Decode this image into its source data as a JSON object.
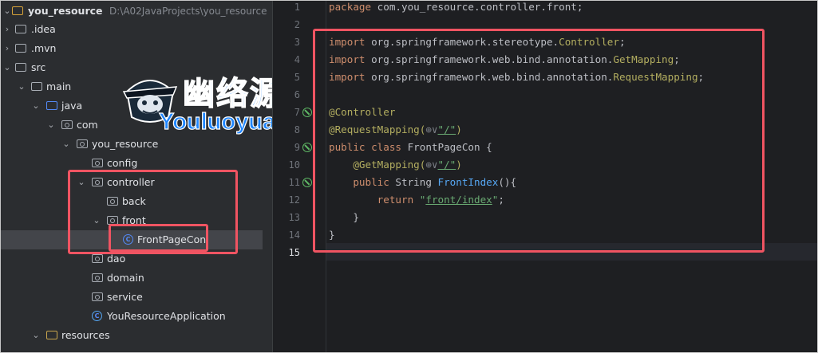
{
  "project": {
    "name": "you_resource",
    "path": "D:\\A02JavaProjects\\you_resource",
    "tree": [
      {
        "label": "you_resource",
        "depth": 0,
        "expanded": true,
        "icon": "folder"
      },
      {
        "label": ".idea",
        "depth": 1,
        "expanded": false,
        "icon": "folder"
      },
      {
        "label": ".mvn",
        "depth": 1,
        "expanded": false,
        "icon": "folder"
      },
      {
        "label": "src",
        "depth": 1,
        "expanded": true,
        "icon": "folder"
      },
      {
        "label": "main",
        "depth": 2,
        "expanded": true,
        "icon": "folder"
      },
      {
        "label": "java",
        "depth": 3,
        "expanded": true,
        "icon": "source-folder"
      },
      {
        "label": "com",
        "depth": 4,
        "expanded": true,
        "icon": "package"
      },
      {
        "label": "you_resource",
        "depth": 5,
        "expanded": true,
        "icon": "package"
      },
      {
        "label": "config",
        "depth": 6,
        "icon": "package"
      },
      {
        "label": "controller",
        "depth": 6,
        "expanded": true,
        "icon": "package"
      },
      {
        "label": "back",
        "depth": 7,
        "icon": "package"
      },
      {
        "label": "front",
        "depth": 7,
        "expanded": true,
        "icon": "package"
      },
      {
        "label": "FrontPageCon",
        "depth": 8,
        "icon": "class",
        "selected": true
      },
      {
        "label": "dao",
        "depth": 6,
        "icon": "package"
      },
      {
        "label": "domain",
        "depth": 6,
        "icon": "package"
      },
      {
        "label": "service",
        "depth": 6,
        "icon": "package"
      },
      {
        "label": "YouResourceApplication",
        "depth": 6,
        "icon": "spring-class"
      },
      {
        "label": "resources",
        "depth": 3,
        "expanded": true,
        "icon": "resources-folder"
      }
    ]
  },
  "editor": {
    "line_numbers": [
      "1",
      "2",
      "3",
      "4",
      "5",
      "6",
      "7",
      "8",
      "9",
      "10",
      "11",
      "12",
      "13",
      "14",
      "15"
    ],
    "lines": {
      "l1": {
        "kw": "package",
        "rest": " com.you_resource.controller.front;"
      },
      "l3": {
        "kw": "import",
        "pkg": " org.springframework.stereotype.",
        "cls": "Controller",
        "end": ";"
      },
      "l4": {
        "kw": "import",
        "pkg": " org.springframework.web.bind.annotation.",
        "cls": "GetMapping",
        "end": ";"
      },
      "l5": {
        "kw": "import",
        "pkg": " org.springframework.web.bind.annotation.",
        "cls": "RequestMapping",
        "end": ";"
      },
      "l7": {
        "ann": "@Controller"
      },
      "l8": {
        "ann": "@RequestMapping(",
        "globe": "⊕∨",
        "str": "\"/\"",
        "end": ")"
      },
      "l9": {
        "kw1": "public",
        "kw2": "class",
        "name": " FrontPageCon {"
      },
      "l10": {
        "ann": "@GetMapping(",
        "globe": "⊕∨",
        "str": "\"/\"",
        "end": ")"
      },
      "l11": {
        "kw": "public",
        "type": " String ",
        "fn": "FrontIndex",
        "end": "(){"
      },
      "l12": {
        "kw": "return",
        "q1": "\"",
        "str": "front/index",
        "q2": "\"",
        "end": ";"
      },
      "l13": {
        "text": "}"
      },
      "l14": {
        "text": "}"
      }
    }
  },
  "watermark": {
    "cn": "幽络源",
    "en": "Youluoyuan"
  },
  "colors": {
    "highlight": "#f05462",
    "accent": "#548af7",
    "keyword": "#cf8e6d",
    "annotation": "#b3ae60",
    "string": "#6aab73",
    "function": "#56a8f5"
  }
}
